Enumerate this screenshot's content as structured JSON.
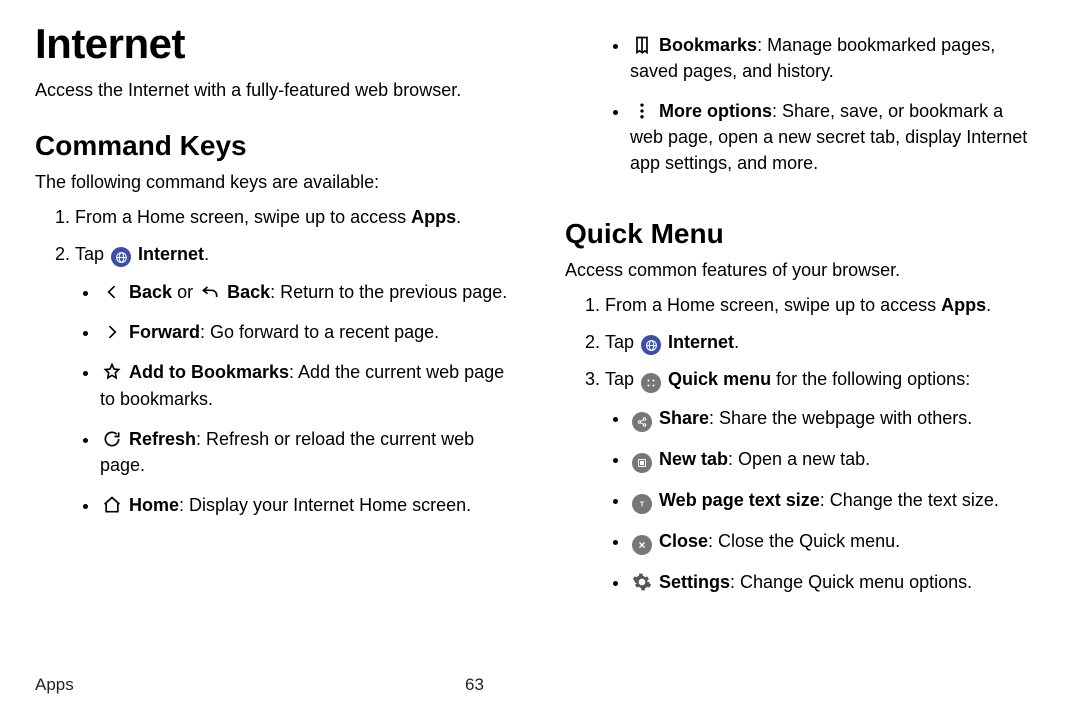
{
  "footer": {
    "section": "Apps",
    "page": "63"
  },
  "title": "Internet",
  "intro": "Access the Internet with a fully-featured web browser.",
  "command_keys": {
    "heading": "Command Keys",
    "sub": "The following command keys are available:",
    "step1_a": "From a Home screen, swipe up to access ",
    "step1_b": "Apps",
    "step1_c": ".",
    "step2_a": "Tap ",
    "step2_b": "Internet",
    "step2_c": ".",
    "bullets": {
      "back_b1": "Back",
      "back_t1": " or ",
      "back_b2": "Back",
      "back_t2": ": Return to the previous page.",
      "fwd_b": "Forward",
      "fwd_t": ": Go forward to a recent page.",
      "bm_b": "Add to Bookmarks",
      "bm_t": ": Add the current web page to bookmarks.",
      "rf_b": "Refresh",
      "rf_t": ": Refresh or reload the current web page.",
      "hm_b": "Home",
      "hm_t": ": Display your Internet Home screen.",
      "bk_b": "Bookmarks",
      "bk_t": ": Manage bookmarked pages, saved pages, and history.",
      "mo_b": "More options",
      "mo_t": ": Share, save, or bookmark a web page, open a new secret tab, display Internet app settings, and more."
    }
  },
  "quick_menu": {
    "heading": "Quick Menu",
    "sub": "Access common features of your browser.",
    "step1_a": "From a Home screen, swipe up to access ",
    "step1_b": "Apps",
    "step1_c": ".",
    "step2_a": "Tap ",
    "step2_b": "Internet",
    "step2_c": ".",
    "step3_a": "Tap ",
    "step3_b": "Quick menu",
    "step3_c": " for the following options:",
    "bullets": {
      "sh_b": "Share",
      "sh_t": ": Share the webpage with others.",
      "nt_b": "New tab",
      "nt_t": ": Open a new tab.",
      "ts_b": "Web page text size",
      "ts_t": ": Change the text size.",
      "cl_b": "Close",
      "cl_t": ": Close the Quick menu.",
      "st_b": "Settings",
      "st_t": ": Change Quick menu options."
    }
  }
}
